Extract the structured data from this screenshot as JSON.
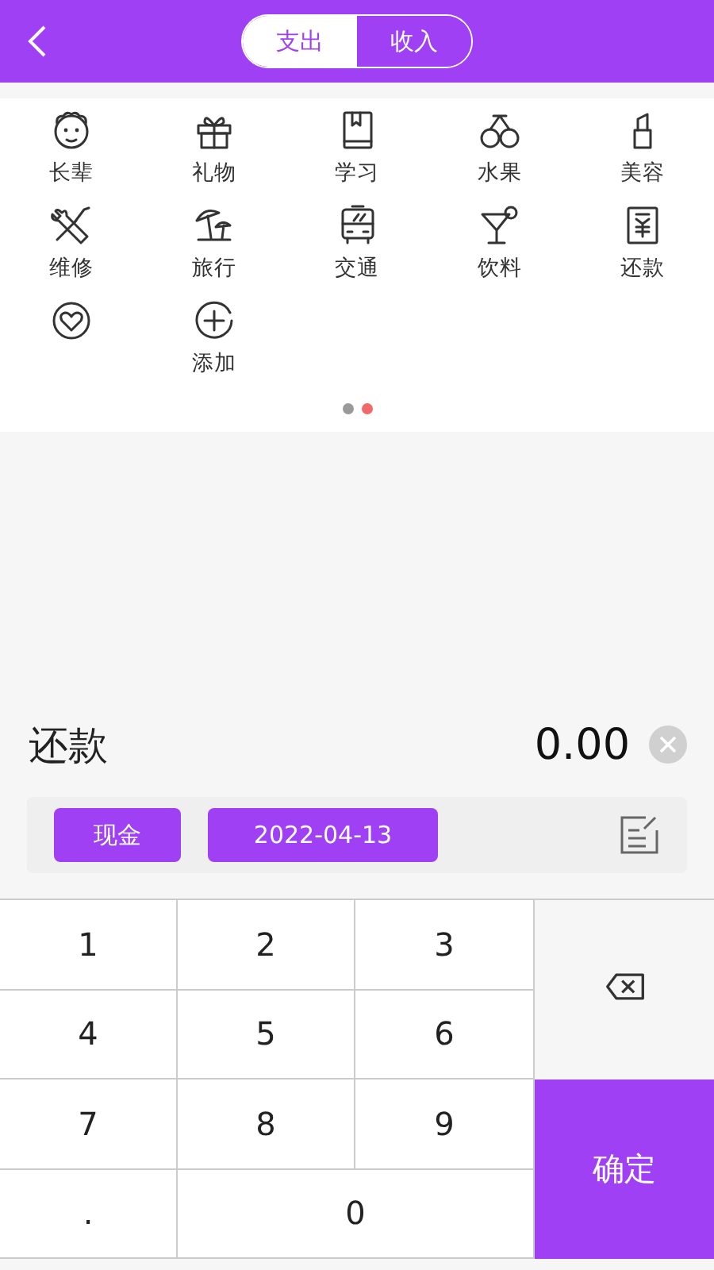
{
  "header": {
    "tabs": [
      {
        "label": "支出",
        "selected": true
      },
      {
        "label": "收入",
        "selected": false
      }
    ]
  },
  "categories": [
    {
      "kind": "elder",
      "label": "长辈"
    },
    {
      "kind": "gift",
      "label": "礼物"
    },
    {
      "kind": "book",
      "label": "学习"
    },
    {
      "kind": "fruit",
      "label": "水果"
    },
    {
      "kind": "lipstick",
      "label": "美容"
    },
    {
      "kind": "tools",
      "label": "维修"
    },
    {
      "kind": "beach",
      "label": "旅行"
    },
    {
      "kind": "bus",
      "label": "交通"
    },
    {
      "kind": "cocktail",
      "label": "饮料"
    },
    {
      "kind": "bill",
      "label": "还款"
    },
    {
      "kind": "heart"
    },
    {
      "kind": "add",
      "label": "添加"
    }
  ],
  "page_dots": [
    {
      "selected": false
    },
    {
      "selected": true
    }
  ],
  "entry": {
    "category": "还款",
    "amount": "0.00",
    "account": "现金",
    "date": "2022-04-13"
  },
  "keypad": [
    {
      "kind": "digit",
      "label": "1"
    },
    {
      "kind": "digit",
      "label": "2"
    },
    {
      "kind": "digit",
      "label": "3"
    },
    {
      "kind": "backspace"
    },
    {
      "kind": "digit",
      "label": "4"
    },
    {
      "kind": "digit",
      "label": "5"
    },
    {
      "kind": "digit",
      "label": "6"
    },
    {
      "kind": "digit",
      "label": "7"
    },
    {
      "kind": "digit",
      "label": "8"
    },
    {
      "kind": "digit",
      "label": "9"
    },
    {
      "kind": "confirm",
      "label": "确定"
    },
    {
      "kind": "digit",
      "label": "."
    },
    {
      "kind": "wide",
      "label": "0"
    }
  ]
}
